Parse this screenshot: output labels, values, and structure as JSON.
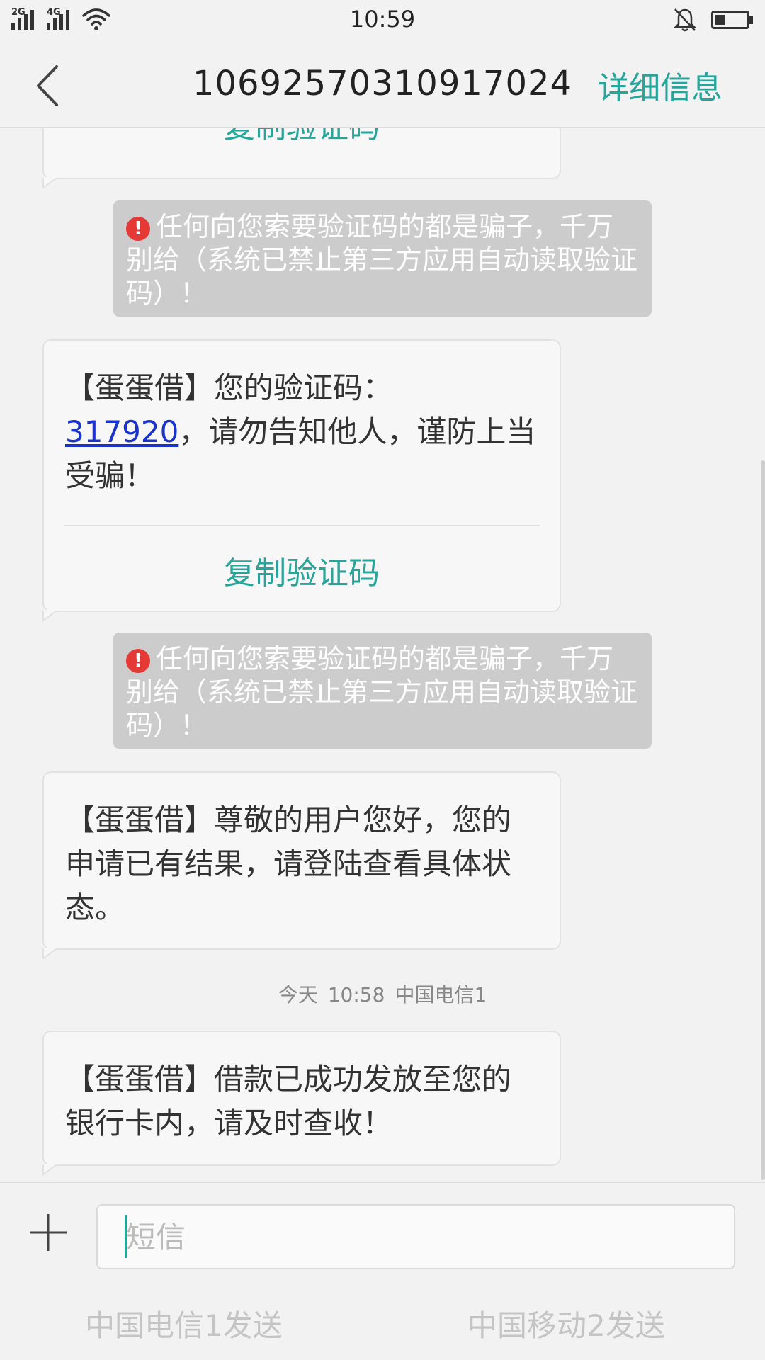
{
  "status_bar": {
    "time": "10:59",
    "network1": "2G",
    "network2": "4G",
    "battery_level_percent": 25
  },
  "header": {
    "back_icon": "chevron-left-icon",
    "title": "10692570310917024",
    "detail_label": "详细信息"
  },
  "messages": [
    {
      "type": "received",
      "copy_label": "复制验证码"
    },
    {
      "type": "warning",
      "text": "任何向您索要验证码的都是骗子，千万别给（系统已禁止第三方应用自动读取验证码）！"
    },
    {
      "type": "received",
      "text_prefix": "【蛋蛋借】您的验证码：",
      "code": "317920",
      "text_suffix": "，请勿告知他人，谨防上当受骗！",
      "copy_label": "复制验证码"
    },
    {
      "type": "warning",
      "text": "任何向您索要验证码的都是骗子，千万别给（系统已禁止第三方应用自动读取验证码）！"
    },
    {
      "type": "received",
      "text": "【蛋蛋借】尊敬的用户您好，您的申请已有结果，请登陆查看具体状态。"
    },
    {
      "type": "received",
      "text": "【蛋蛋借】借款已成功发放至您的银行卡内，请及时查收！"
    }
  ],
  "timestamp": {
    "day": "今天",
    "time": "10:58",
    "carrier": "中国电信1"
  },
  "composer": {
    "placeholder": "短信",
    "plus_icon": "plus-icon",
    "send_sim1": "中国电信1发送",
    "send_sim2": "中国移动2发送"
  },
  "colors": {
    "accent": "#26a69a",
    "warning_bg": "#cccccc",
    "warning_icon": "#e53935",
    "link": "#1a33cc"
  }
}
